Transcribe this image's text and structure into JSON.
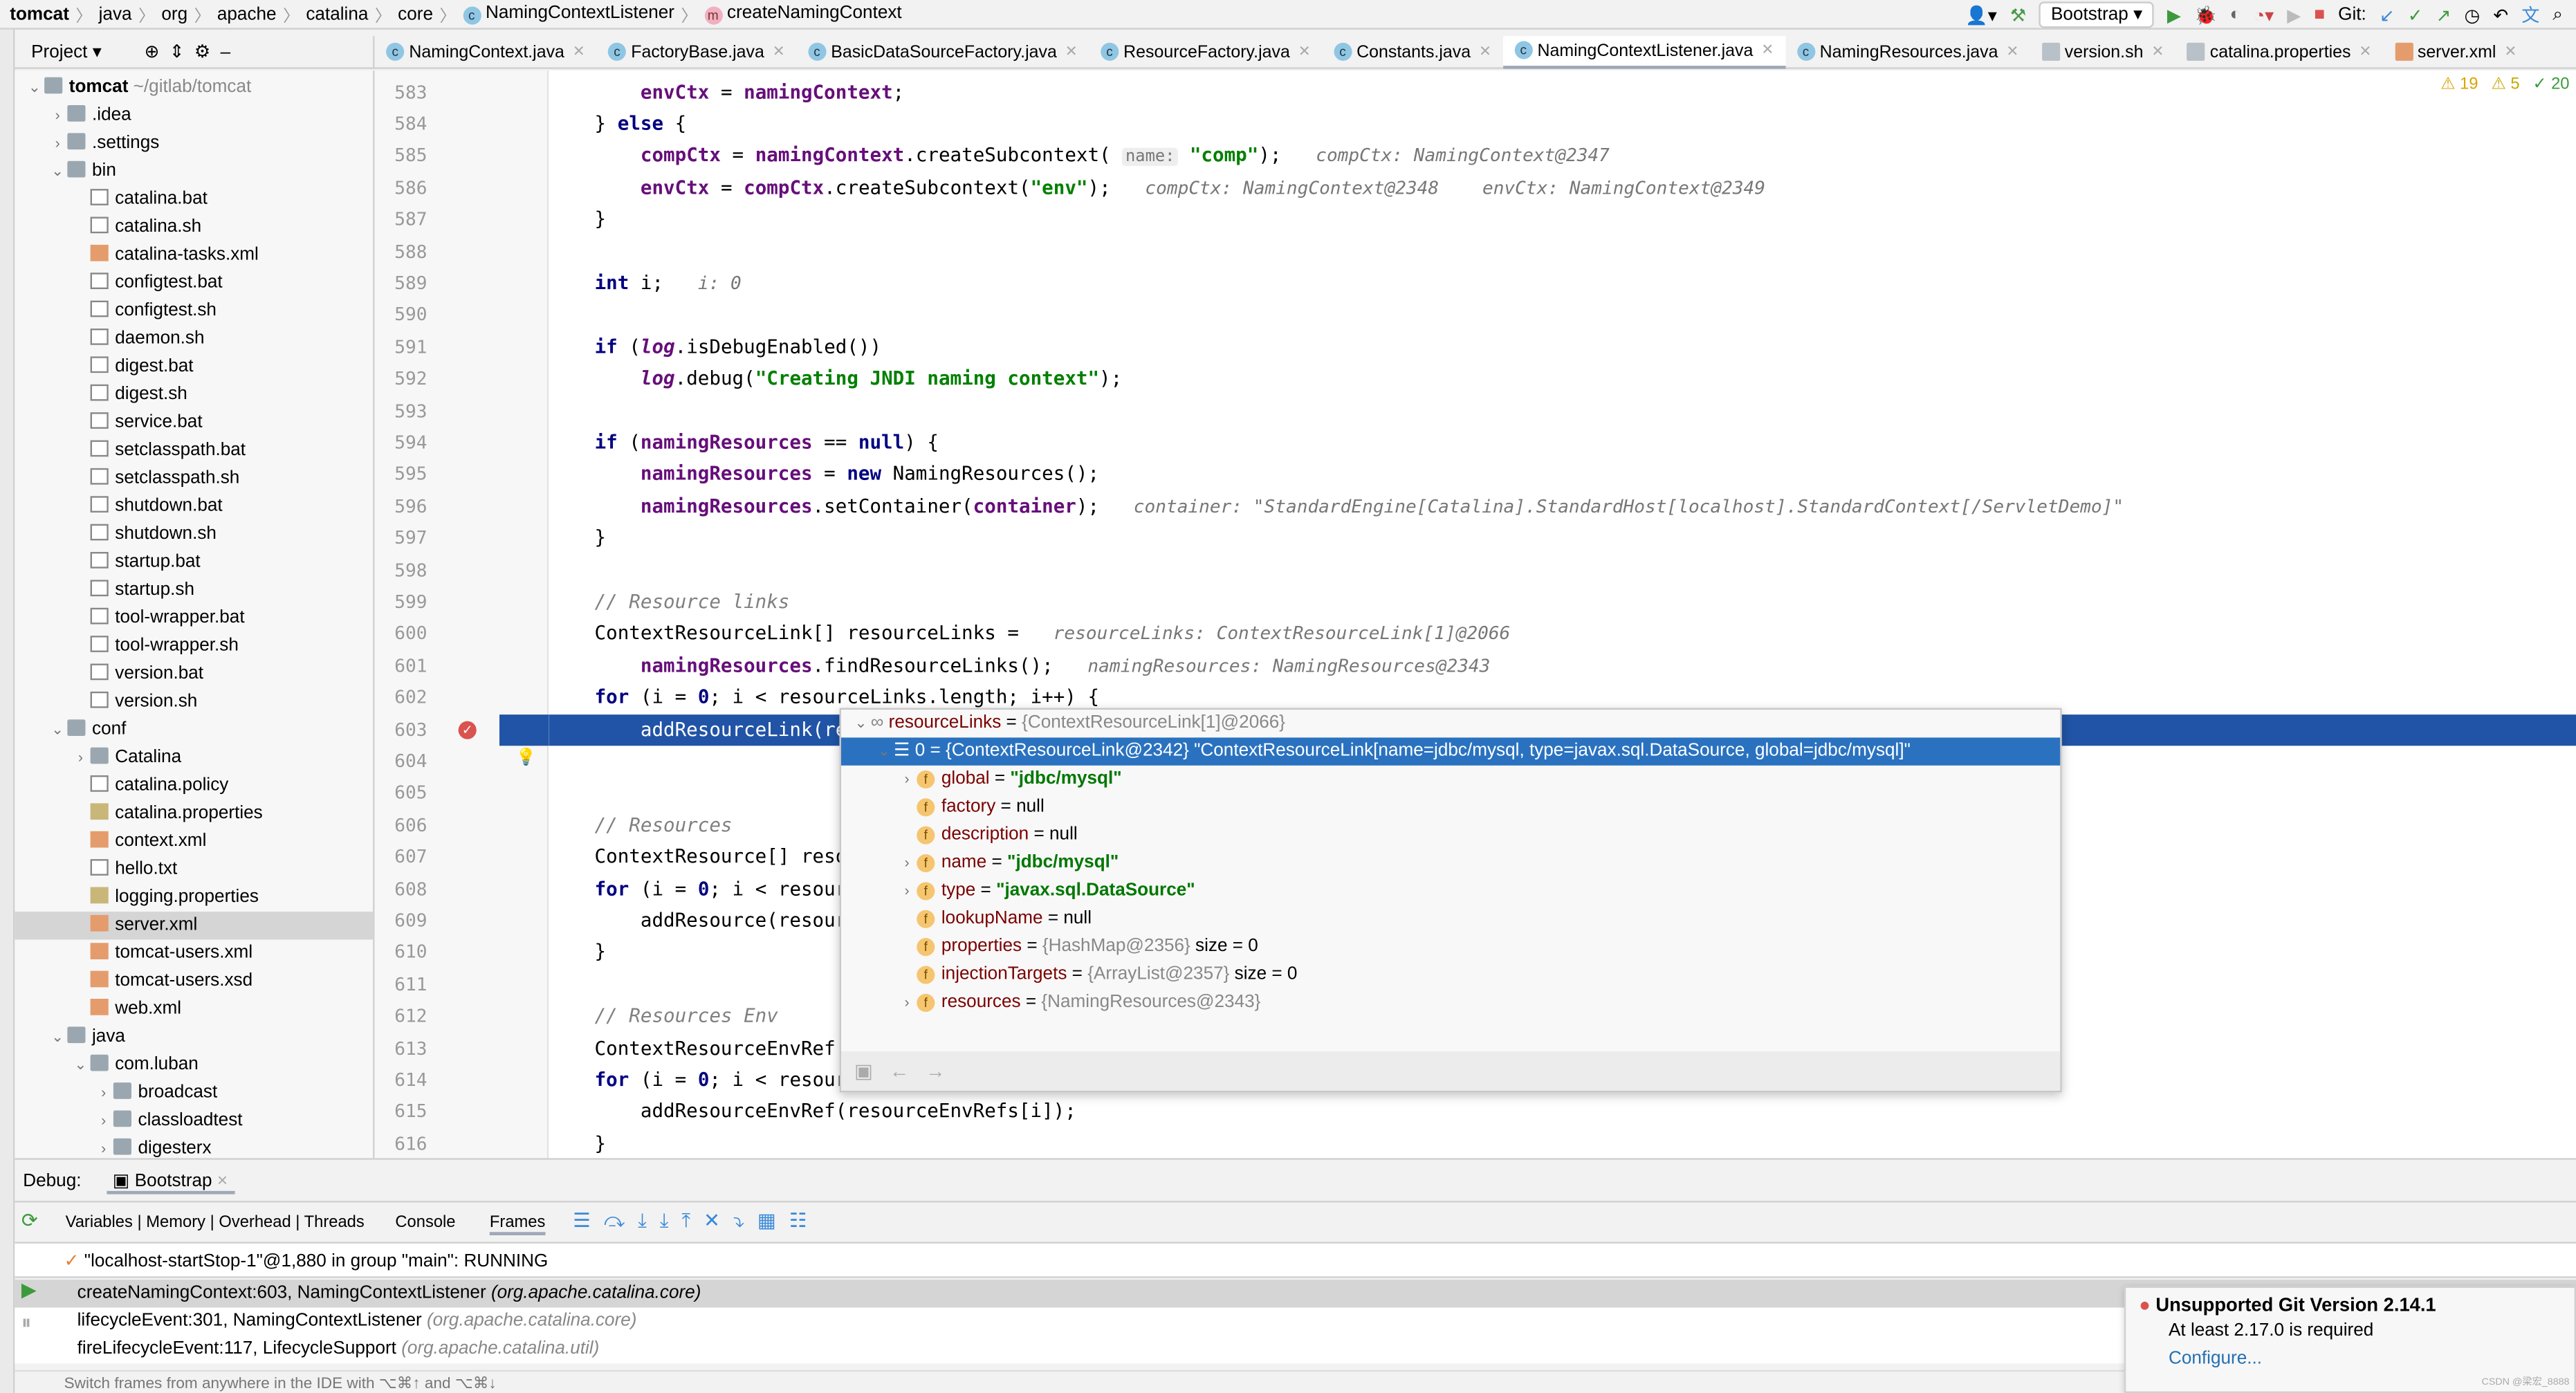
{
  "breadcrumb": [
    "tomcat",
    "java",
    "org",
    "apache",
    "catalina",
    "core",
    "NamingContextListener",
    "createNamingContext"
  ],
  "run_config": "Bootstrap",
  "git_label": "Git:",
  "project_label": "Project",
  "editor_tabs": [
    {
      "label": "NamingContext.java",
      "icon": "class-icon"
    },
    {
      "label": "FactoryBase.java",
      "icon": "class-icon"
    },
    {
      "label": "BasicDataSourceFactory.java",
      "icon": "class-icon"
    },
    {
      "label": "ResourceFactory.java",
      "icon": "class-icon"
    },
    {
      "label": "Constants.java",
      "icon": "class-icon"
    },
    {
      "label": "NamingContextListener.java",
      "icon": "class-icon",
      "active": true
    },
    {
      "label": "NamingResources.java",
      "icon": "class-icon"
    },
    {
      "label": "version.sh",
      "icon": "file-icon"
    },
    {
      "label": "catalina.properties",
      "icon": "properties-icon"
    },
    {
      "label": "server.xml",
      "icon": "xml-icon"
    }
  ],
  "inspections": {
    "errors": "19",
    "warnings": "5",
    "ok": "20"
  },
  "tree": [
    {
      "l": 0,
      "t": "tomcat",
      "extra": "~/gitlab/tomcat",
      "type": "folder",
      "open": true,
      "bold": true
    },
    {
      "l": 1,
      "t": ".idea",
      "type": "folder",
      "open": false
    },
    {
      "l": 1,
      "t": ".settings",
      "type": "folder",
      "open": false
    },
    {
      "l": 1,
      "t": "bin",
      "type": "folder",
      "open": true
    },
    {
      "l": 2,
      "t": "catalina.bat",
      "type": "file"
    },
    {
      "l": 2,
      "t": "catalina.sh",
      "type": "file"
    },
    {
      "l": 2,
      "t": "catalina-tasks.xml",
      "type": "xml"
    },
    {
      "l": 2,
      "t": "configtest.bat",
      "type": "file"
    },
    {
      "l": 2,
      "t": "configtest.sh",
      "type": "file"
    },
    {
      "l": 2,
      "t": "daemon.sh",
      "type": "file"
    },
    {
      "l": 2,
      "t": "digest.bat",
      "type": "file"
    },
    {
      "l": 2,
      "t": "digest.sh",
      "type": "file"
    },
    {
      "l": 2,
      "t": "service.bat",
      "type": "file"
    },
    {
      "l": 2,
      "t": "setclasspath.bat",
      "type": "file"
    },
    {
      "l": 2,
      "t": "setclasspath.sh",
      "type": "file"
    },
    {
      "l": 2,
      "t": "shutdown.bat",
      "type": "file"
    },
    {
      "l": 2,
      "t": "shutdown.sh",
      "type": "file"
    },
    {
      "l": 2,
      "t": "startup.bat",
      "type": "file"
    },
    {
      "l": 2,
      "t": "startup.sh",
      "type": "file"
    },
    {
      "l": 2,
      "t": "tool-wrapper.bat",
      "type": "file"
    },
    {
      "l": 2,
      "t": "tool-wrapper.sh",
      "type": "file"
    },
    {
      "l": 2,
      "t": "version.bat",
      "type": "file"
    },
    {
      "l": 2,
      "t": "version.sh",
      "type": "file"
    },
    {
      "l": 1,
      "t": "conf",
      "type": "folder",
      "open": true
    },
    {
      "l": 2,
      "t": "Catalina",
      "type": "folder",
      "open": false
    },
    {
      "l": 2,
      "t": "catalina.policy",
      "type": "file"
    },
    {
      "l": 2,
      "t": "catalina.properties",
      "type": "prop"
    },
    {
      "l": 2,
      "t": "context.xml",
      "type": "xml"
    },
    {
      "l": 2,
      "t": "hello.txt",
      "type": "file"
    },
    {
      "l": 2,
      "t": "logging.properties",
      "type": "prop"
    },
    {
      "l": 2,
      "t": "server.xml",
      "type": "xml",
      "selected": true
    },
    {
      "l": 2,
      "t": "tomcat-users.xml",
      "type": "xml"
    },
    {
      "l": 2,
      "t": "tomcat-users.xsd",
      "type": "xml"
    },
    {
      "l": 2,
      "t": "web.xml",
      "type": "xml"
    },
    {
      "l": 1,
      "t": "java",
      "type": "folder",
      "open": true
    },
    {
      "l": 2,
      "t": "com.luban",
      "type": "folder",
      "open": true
    },
    {
      "l": 3,
      "t": "broadcast",
      "type": "folder",
      "open": false
    },
    {
      "l": 3,
      "t": "classloadtest",
      "type": "folder",
      "open": false
    },
    {
      "l": 3,
      "t": "digesterx",
      "type": "folder",
      "open": false
    }
  ],
  "code": [
    {
      "n": "583",
      "tk": [
        [
          "",
          "        "
        ],
        [
          "f",
          "envCtx"
        ],
        [
          "",
          " = "
        ],
        [
          "f",
          "namingContext"
        ],
        [
          "",
          ";"
        ]
      ]
    },
    {
      "n": "584",
      "tk": [
        [
          "",
          "    } "
        ],
        [
          "k",
          "else"
        ],
        [
          "",
          " {"
        ]
      ]
    },
    {
      "n": "585",
      "tk": [
        [
          "",
          "        "
        ],
        [
          "f",
          "compCtx"
        ],
        [
          "",
          " = "
        ],
        [
          "f",
          "namingContext"
        ],
        [
          "",
          ".createSubcontext( "
        ],
        [
          "pn",
          "name:"
        ],
        [
          "",
          " "
        ],
        [
          "s",
          "\"comp\""
        ],
        [
          "",
          ");   "
        ],
        [
          "h",
          "compCtx: NamingContext@2347"
        ]
      ]
    },
    {
      "n": "586",
      "tk": [
        [
          "",
          "        "
        ],
        [
          "f",
          "envCtx"
        ],
        [
          "",
          " = "
        ],
        [
          "f",
          "compCtx"
        ],
        [
          "",
          ".createSubcontext("
        ],
        [
          "s",
          "\"env\""
        ],
        [
          "",
          ");   "
        ],
        [
          "h",
          "compCtx: NamingContext@2348    envCtx: NamingContext@2349"
        ]
      ]
    },
    {
      "n": "587",
      "tk": [
        [
          "",
          "    }"
        ]
      ]
    },
    {
      "n": "588",
      "tk": []
    },
    {
      "n": "589",
      "tk": [
        [
          "",
          "    "
        ],
        [
          "k",
          "int"
        ],
        [
          "",
          " i;   "
        ],
        [
          "h",
          "i: 0"
        ]
      ]
    },
    {
      "n": "590",
      "tk": []
    },
    {
      "n": "591",
      "tk": [
        [
          "",
          "    "
        ],
        [
          "k",
          "if"
        ],
        [
          "",
          " ("
        ],
        [
          "it",
          "log"
        ],
        [
          "",
          ".isDebugEnabled())"
        ]
      ]
    },
    {
      "n": "592",
      "tk": [
        [
          "",
          "        "
        ],
        [
          "it",
          "log"
        ],
        [
          "",
          ".debug("
        ],
        [
          "s",
          "\"Creating JNDI naming context\""
        ],
        [
          "",
          ");"
        ]
      ]
    },
    {
      "n": "593",
      "tk": []
    },
    {
      "n": "594",
      "tk": [
        [
          "",
          "    "
        ],
        [
          "k",
          "if"
        ],
        [
          "",
          " ("
        ],
        [
          "f",
          "namingResources"
        ],
        [
          "",
          " == "
        ],
        [
          "k",
          "null"
        ],
        [
          "",
          ") {"
        ]
      ]
    },
    {
      "n": "595",
      "tk": [
        [
          "",
          "        "
        ],
        [
          "f",
          "namingResources"
        ],
        [
          "",
          " = "
        ],
        [
          "k",
          "new"
        ],
        [
          "",
          " NamingResources();"
        ]
      ]
    },
    {
      "n": "596",
      "tk": [
        [
          "",
          "        "
        ],
        [
          "f",
          "namingResources"
        ],
        [
          "",
          ".setContainer("
        ],
        [
          "f",
          "container"
        ],
        [
          "",
          ");   "
        ],
        [
          "h",
          "container: \"StandardEngine[Catalina].StandardHost[localhost].StandardContext[/ServletDemo]\""
        ]
      ]
    },
    {
      "n": "597",
      "tk": [
        [
          "",
          "    }"
        ]
      ]
    },
    {
      "n": "598",
      "tk": []
    },
    {
      "n": "599",
      "tk": [
        [
          "",
          "    "
        ],
        [
          "cm",
          "// Resource links"
        ]
      ]
    },
    {
      "n": "600",
      "tk": [
        [
          "",
          "    ContextResourceLink[] resourceLinks =   "
        ],
        [
          "h",
          "resourceLinks: ContextResourceLink[1]@2066"
        ]
      ]
    },
    {
      "n": "601",
      "tk": [
        [
          "",
          "        "
        ],
        [
          "f",
          "namingResources"
        ],
        [
          "",
          ".findResourceLinks();   "
        ],
        [
          "h",
          "namingResources: NamingResources@2343"
        ]
      ]
    },
    {
      "n": "602",
      "tk": [
        [
          "",
          "    "
        ],
        [
          "k",
          "for"
        ],
        [
          "",
          " (i = "
        ],
        [
          "k",
          "0"
        ],
        [
          "",
          "; i < resourceLinks.length; i++) {"
        ]
      ]
    },
    {
      "n": "603",
      "tk": [
        [
          "",
          "        addResourceLink(re"
        ]
      ],
      "current": true,
      "breakpoint": true
    },
    {
      "n": "604",
      "tk": [],
      "bulb": true
    },
    {
      "n": "605",
      "tk": []
    },
    {
      "n": "606",
      "tk": [
        [
          "",
          "    "
        ],
        [
          "cm",
          "// Resources"
        ]
      ]
    },
    {
      "n": "607",
      "tk": [
        [
          "",
          "    ContextResource[] reso"
        ]
      ]
    },
    {
      "n": "608",
      "tk": [
        [
          "",
          "    "
        ],
        [
          "k",
          "for"
        ],
        [
          "",
          " (i = "
        ],
        [
          "k",
          "0"
        ],
        [
          "",
          "; i < resour"
        ]
      ]
    },
    {
      "n": "609",
      "tk": [
        [
          "",
          "        addResource(resour"
        ]
      ]
    },
    {
      "n": "610",
      "tk": [
        [
          "",
          "    }"
        ]
      ]
    },
    {
      "n": "611",
      "tk": []
    },
    {
      "n": "612",
      "tk": [
        [
          "",
          "    "
        ],
        [
          "cm",
          "// Resources Env"
        ]
      ]
    },
    {
      "n": "613",
      "tk": [
        [
          "",
          "    ContextResourceEnvRef["
        ]
      ]
    },
    {
      "n": "614",
      "tk": [
        [
          "",
          "    "
        ],
        [
          "k",
          "for"
        ],
        [
          "",
          " (i = "
        ],
        [
          "k",
          "0"
        ],
        [
          "",
          "; i < resour"
        ]
      ]
    },
    {
      "n": "615",
      "tk": [
        [
          "",
          "        addResourceEnvRef(resourceEnvRefs[i]);"
        ]
      ]
    },
    {
      "n": "616",
      "tk": [
        [
          "",
          "    }"
        ]
      ]
    }
  ],
  "popup": {
    "root": {
      "name": "resourceLinks",
      "value": "{ContextResourceLink[1]@2066}"
    },
    "selected": {
      "name": "0",
      "value": "{ContextResourceLink@2342} \"ContextResourceLink[name=jdbc/mysql, type=javax.sql.DataSource, global=jdbc/mysql]\""
    },
    "fields": [
      {
        "name": "global",
        "value": "\"jdbc/mysql\"",
        "kind": "str",
        "expand": true
      },
      {
        "name": "factory",
        "value": "null",
        "kind": "plain"
      },
      {
        "name": "description",
        "value": "null",
        "kind": "plain"
      },
      {
        "name": "name",
        "value": "\"jdbc/mysql\"",
        "kind": "str",
        "expand": true
      },
      {
        "name": "type",
        "value": "\"javax.sql.DataSource\"",
        "kind": "str",
        "expand": true
      },
      {
        "name": "lookupName",
        "value": "null",
        "kind": "plain"
      },
      {
        "name": "properties",
        "value": "{HashMap@2356}",
        "extra": "size = 0",
        "kind": "ref"
      },
      {
        "name": "injectionTargets",
        "value": "{ArrayList@2357}",
        "extra": "size = 0",
        "kind": "ref"
      },
      {
        "name": "resources",
        "value": "{NamingResources@2343}",
        "kind": "ref",
        "expand": true
      }
    ]
  },
  "debug": {
    "label": "Debug:",
    "session": "Bootstrap",
    "tabs": [
      "Variables | Memory | Overhead | Threads",
      "Console",
      "Frames"
    ],
    "thread": "\"localhost-startStop-1\"@1,880 in group \"main\": RUNNING",
    "frames": [
      {
        "m": "createNamingContext:603, NamingContextListener",
        "p": "(org.apache.catalina.core)"
      },
      {
        "m": "lifecycleEvent:301, NamingContextListener",
        "p": "(org.apache.catalina.core)"
      },
      {
        "m": "fireLifecycleEvent:117, LifecycleSupport",
        "p": "(org.apache.catalina.util)"
      }
    ],
    "hint": "Switch frames from anywhere in the IDE with ⌥⌘↑ and ⌥⌘↓"
  },
  "notification": {
    "title": "Unsupported Git Version 2.14.1",
    "body": "At least 2.17.0 is required",
    "link": "Configure..."
  },
  "watermark": "CSDN @梁宏_8888"
}
